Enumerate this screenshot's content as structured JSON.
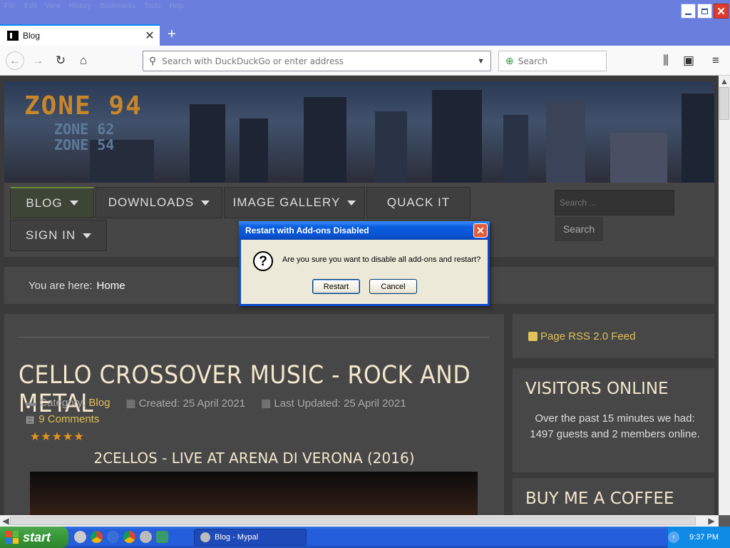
{
  "menubar": [
    "File",
    "Edit",
    "View",
    "History",
    "Bookmarks",
    "Tools",
    "Help"
  ],
  "tab": {
    "title": "Blog"
  },
  "urlbar": {
    "placeholder": "Search with DuckDuckGo or enter address"
  },
  "searchbar": {
    "placeholder": "Search"
  },
  "banner": {
    "logo_main": "ZONE 94",
    "logo_sub1": "ZONE 62",
    "logo_sub2": "ZONE 54"
  },
  "site_nav": {
    "items": [
      "BLOG",
      "DOWNLOADS",
      "IMAGE GALLERY",
      "QUACK IT",
      "SIGN IN"
    ],
    "search_placeholder": "Search ...",
    "search_button": "Search"
  },
  "breadcrumb": {
    "label": "You are here:",
    "home": "Home"
  },
  "article": {
    "title": "CELLO CROSSOVER MUSIC - ROCK AND METAL",
    "category_label": "Category:",
    "category": "Blog",
    "created": "Created: 25 April 2021",
    "updated": "Last Updated: 25 April 2021",
    "comments": "9 Comments",
    "stars": "★★★★★",
    "subtitle": "2CELLOS - LIVE AT ARENA DI VERONA (2016)"
  },
  "sidebar": {
    "rss": "Page RSS 2.0 Feed",
    "visitors_title": "VISITORS ONLINE",
    "visitors_text": "Over the past 15 minutes we had: 1497 guests and 2 members online.",
    "coffee_title": "BUY ME A COFFEE"
  },
  "dialog": {
    "title": "Restart with Add-ons Disabled",
    "message": "Are you sure you want to disable all add-ons and restart?",
    "restart": "Restart",
    "cancel": "Cancel"
  },
  "taskbar": {
    "start": "start",
    "task": "Blog - Mypal",
    "clock": "9:37 PM"
  },
  "colors": {
    "xp_blue": "#245edb",
    "dialog_title": "#0a5ee0",
    "accent_gold": "#e0c25a",
    "firefox_frame": "#6a7fdd"
  }
}
